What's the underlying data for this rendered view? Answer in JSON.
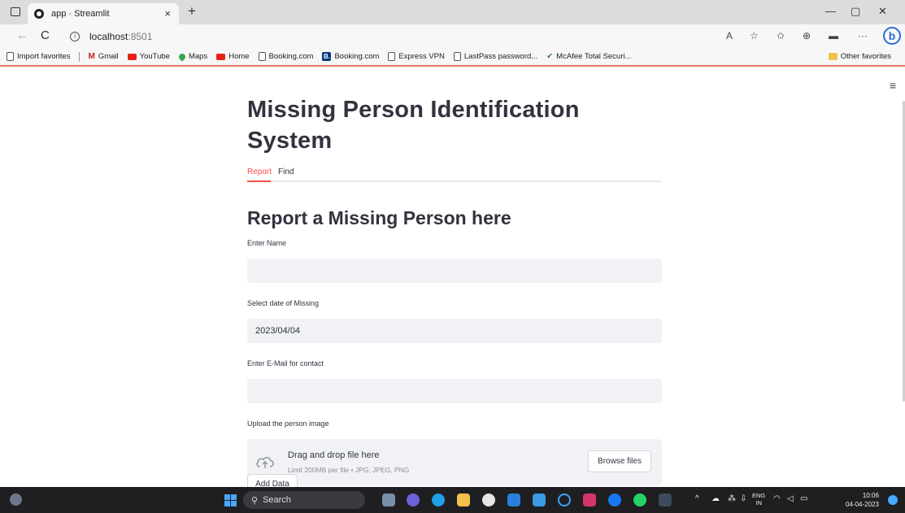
{
  "browser": {
    "tab_title": "app · Streamlit",
    "tab_close": "×",
    "new_tab": "+",
    "url_host": "localhost",
    "url_port": ":8501",
    "window_minimize": "—",
    "window_restore": "▢",
    "window_close": "✕",
    "back_icon": "←",
    "reload_icon": "C",
    "more_tools": "···",
    "favorites": [
      {
        "label": "Import favorites",
        "icon": "import-icon"
      },
      {
        "label": "Gmail",
        "icon": "gmail-icon"
      },
      {
        "label": "YouTube",
        "icon": "youtube-icon"
      },
      {
        "label": "Maps",
        "icon": "maps-icon"
      },
      {
        "label": "Home",
        "icon": "youtube-icon"
      },
      {
        "label": "Booking.com",
        "icon": "page-icon"
      },
      {
        "label": "Booking.com",
        "icon": "booking-icon"
      },
      {
        "label": "Express VPN",
        "icon": "page-icon"
      },
      {
        "label": "LastPass password...",
        "icon": "page-icon"
      },
      {
        "label": "McAfee Total Securi...",
        "icon": "mcafee-icon"
      }
    ],
    "other_favorites": "Other favorites"
  },
  "app": {
    "title": "Missing Person Identification System",
    "tabs": [
      {
        "label": "Report",
        "active": true
      },
      {
        "label": "Find",
        "active": false
      }
    ],
    "section_title": "Report a Missing Person here",
    "name_label": "Enter Name",
    "name_value": "",
    "date_label": "Select date of Missing",
    "date_value": "2023/04/04",
    "email_label": "Enter E-Mail for contact",
    "email_value": "",
    "upload_label": "Upload the person image",
    "upload_drop_text": "Drag and drop file here",
    "upload_limit_text": "Limit 200MB per file • JPG, JPEG, PNG",
    "browse_button": "Browse files",
    "add_button": "Add Data",
    "menu_icon": "≡"
  },
  "taskbar": {
    "search_label": "Search",
    "lang_top": "ENG",
    "lang_bottom": "IN",
    "time": "10:06",
    "date": "04-04-2023",
    "chevron": "^"
  },
  "colors": {
    "accent": "#ff4b4b",
    "input_bg": "#f0f2f6",
    "text": "#31333f",
    "taskbar": "#1f1f22"
  }
}
